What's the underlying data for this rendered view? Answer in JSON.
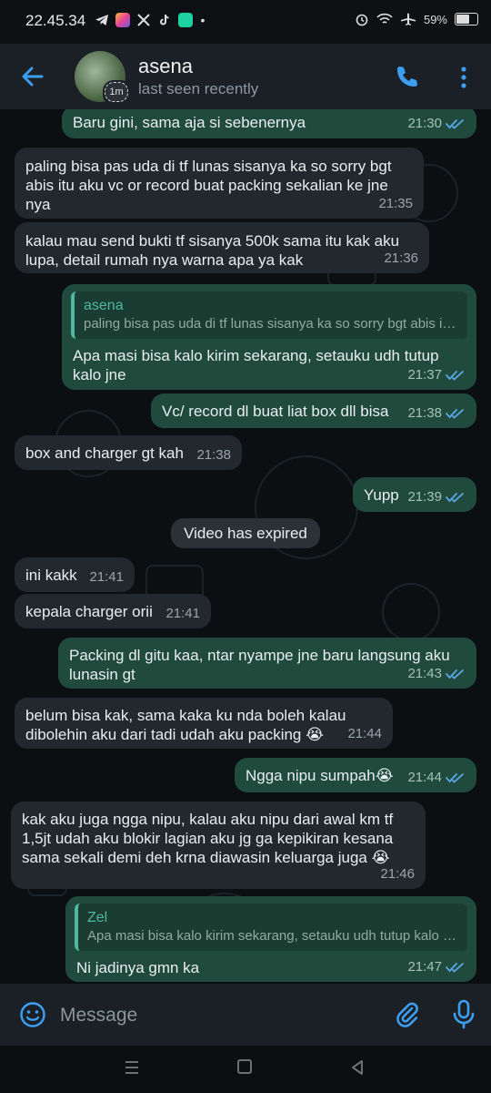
{
  "status_bar": {
    "time": "22.45.34",
    "battery": "59%",
    "app_icons": [
      "telegram-icon",
      "gallery-icon",
      "x-icon",
      "tiktok-icon",
      "messenger-icon",
      "dot-icon"
    ],
    "system_icons": [
      "alarm-icon",
      "wifi-icon",
      "airplane-icon",
      "battery-icon"
    ]
  },
  "header": {
    "contact_name": "asena",
    "status": "last seen recently",
    "story_badge": "1m"
  },
  "messages": [
    {
      "dir": "out",
      "text": "Baru gini, sama aja si sebenernya",
      "time": "21:30",
      "read": true
    },
    {
      "dir": "in",
      "text": "paling bisa pas uda di tf lunas sisanya ka so sorry bgt abis itu aku vc or record buat packing sekalian ke jne nya",
      "time": "21:35"
    },
    {
      "dir": "in",
      "text": "kalau mau send bukti tf sisanya 500k sama itu kak aku lupa, detail rumah nya warna apa ya kak",
      "time": "21:36"
    },
    {
      "dir": "out",
      "quote_name": "asena",
      "quote_text": "paling bisa pas uda di tf lunas sisanya ka so sorry bgt abis itu aku vc or record buat packing",
      "text": "Apa masi bisa kalo kirim sekarang, setauku udh tutup kalo jne",
      "time": "21:37",
      "read": true
    },
    {
      "dir": "out",
      "text": "Vc/ record dl buat liat box dll bisa",
      "time": "21:38",
      "read": true
    },
    {
      "dir": "in",
      "text": "box and charger gt kah",
      "time": "21:38"
    },
    {
      "dir": "out",
      "text": "Yupp",
      "time": "21:39",
      "read": true
    },
    {
      "dir": "in",
      "text": "ini kakk",
      "time": "21:41"
    },
    {
      "dir": "in",
      "text": "kepala charger orii",
      "time": "21:41"
    },
    {
      "dir": "out",
      "text": "Packing dl gitu kaa, ntar nyampe jne baru langsung aku lunasin gt",
      "time": "21:43",
      "read": true
    },
    {
      "dir": "in",
      "text": "belum bisa kak, sama kaka ku nda boleh kalau dibolehin aku dari tadi udah aku packing 😭",
      "time": "21:44"
    },
    {
      "dir": "out",
      "text": "Ngga nipu sumpah😭",
      "time": "21:44",
      "read": true
    },
    {
      "dir": "in",
      "text": "kak aku juga ngga nipu, kalau aku nipu dari awal km tf 1,5jt udah aku blokir lagian aku jg ga kepikiran kesana sama sekali demi deh krna diawasin keluarga juga 😭",
      "time": "21:46"
    },
    {
      "dir": "out",
      "quote_name": "Zel",
      "quote_text": "Apa masi bisa kalo kirim sekarang, setauku udh tutup kalo jne",
      "text": "Ni jadinya gmn ka",
      "time": "21:47",
      "read": true
    }
  ],
  "system_message": "Video has expired",
  "input": {
    "placeholder": "Message"
  },
  "colors": {
    "accent": "#3d9ef0",
    "outgoing_bubble": "#1f4a3c",
    "incoming_bubble": "#22282e",
    "header": "#1a2026"
  }
}
